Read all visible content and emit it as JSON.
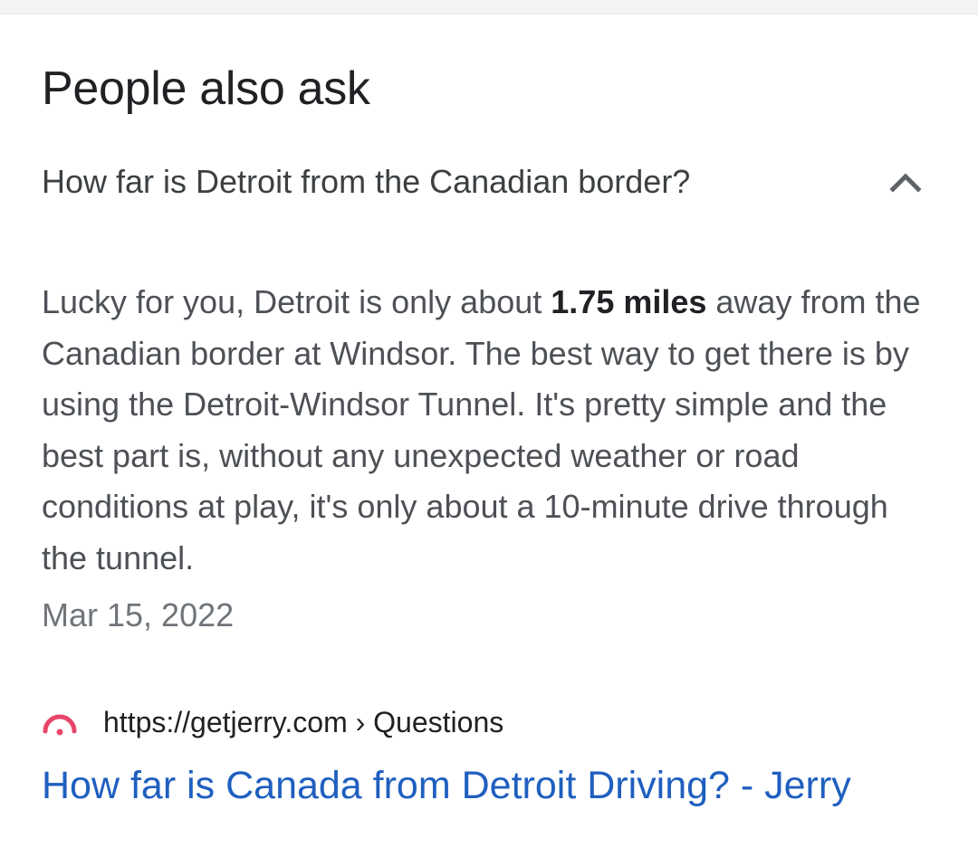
{
  "section": {
    "title": "People also ask"
  },
  "question": {
    "text": "How far is Detroit from the Canadian border?",
    "chevron_icon": "chevron-up-icon",
    "expanded": true
  },
  "answer": {
    "before_bold": "Lucky for you, Detroit is only about ",
    "bold": "1.75 miles",
    "after_bold": " away from the Canadian border at Windsor. The best way to get there is by using the Detroit-Windsor Tunnel. It's pretty simple and the best part is, without any unexpected weather or road conditions at play, it's only about a 10-minute drive through the tunnel.",
    "date": "Mar 15, 2022"
  },
  "source": {
    "favicon": "jerry-favicon",
    "url": "https://getjerry.com › Questions",
    "title": "How far is Canada from Detroit Driving? - Jerry"
  },
  "colors": {
    "link": "#1f5fbf",
    "favicon": "#e8456a",
    "topbar": "#f1f3f4"
  }
}
